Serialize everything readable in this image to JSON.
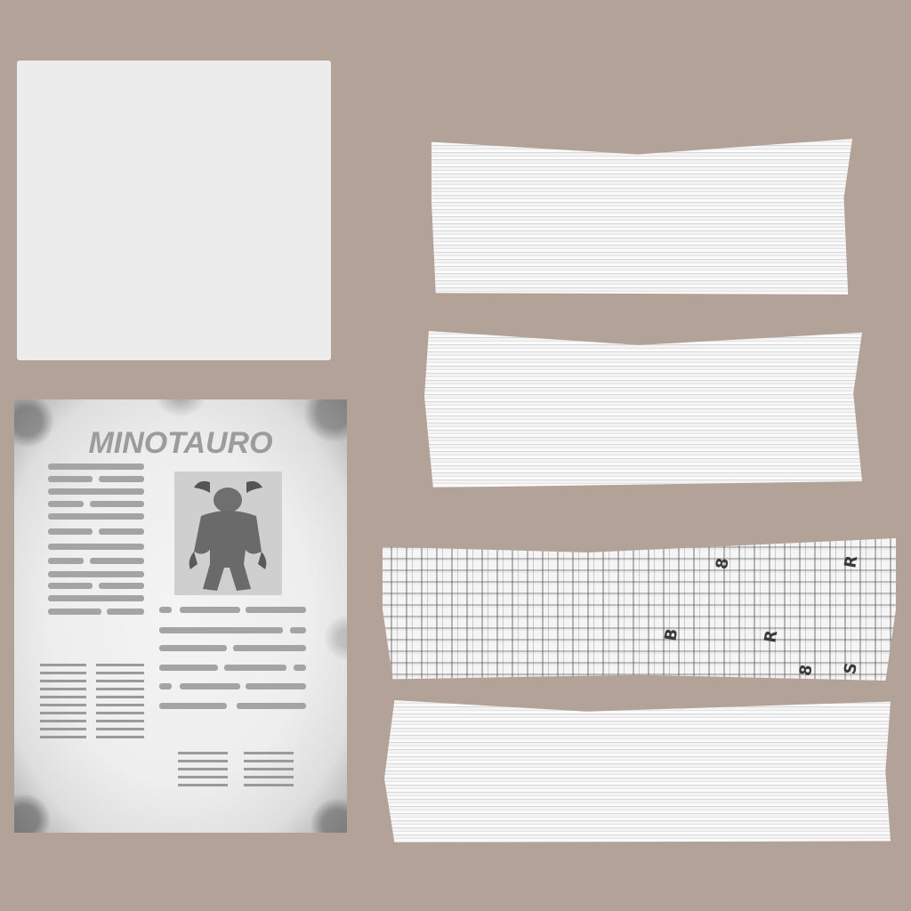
{
  "texture_atlas": {
    "front_page": {
      "headline": "MINOTAURO",
      "illustration": "minotaur-figure"
    },
    "rolled_newspaper_glyphs": [
      "8",
      "R",
      "B",
      "8",
      "R",
      "S"
    ]
  },
  "colors": {
    "background": "#b2a298",
    "paper": "#ececec",
    "text_bars": "#a4a4a4",
    "headline": "#9c9c9c"
  }
}
